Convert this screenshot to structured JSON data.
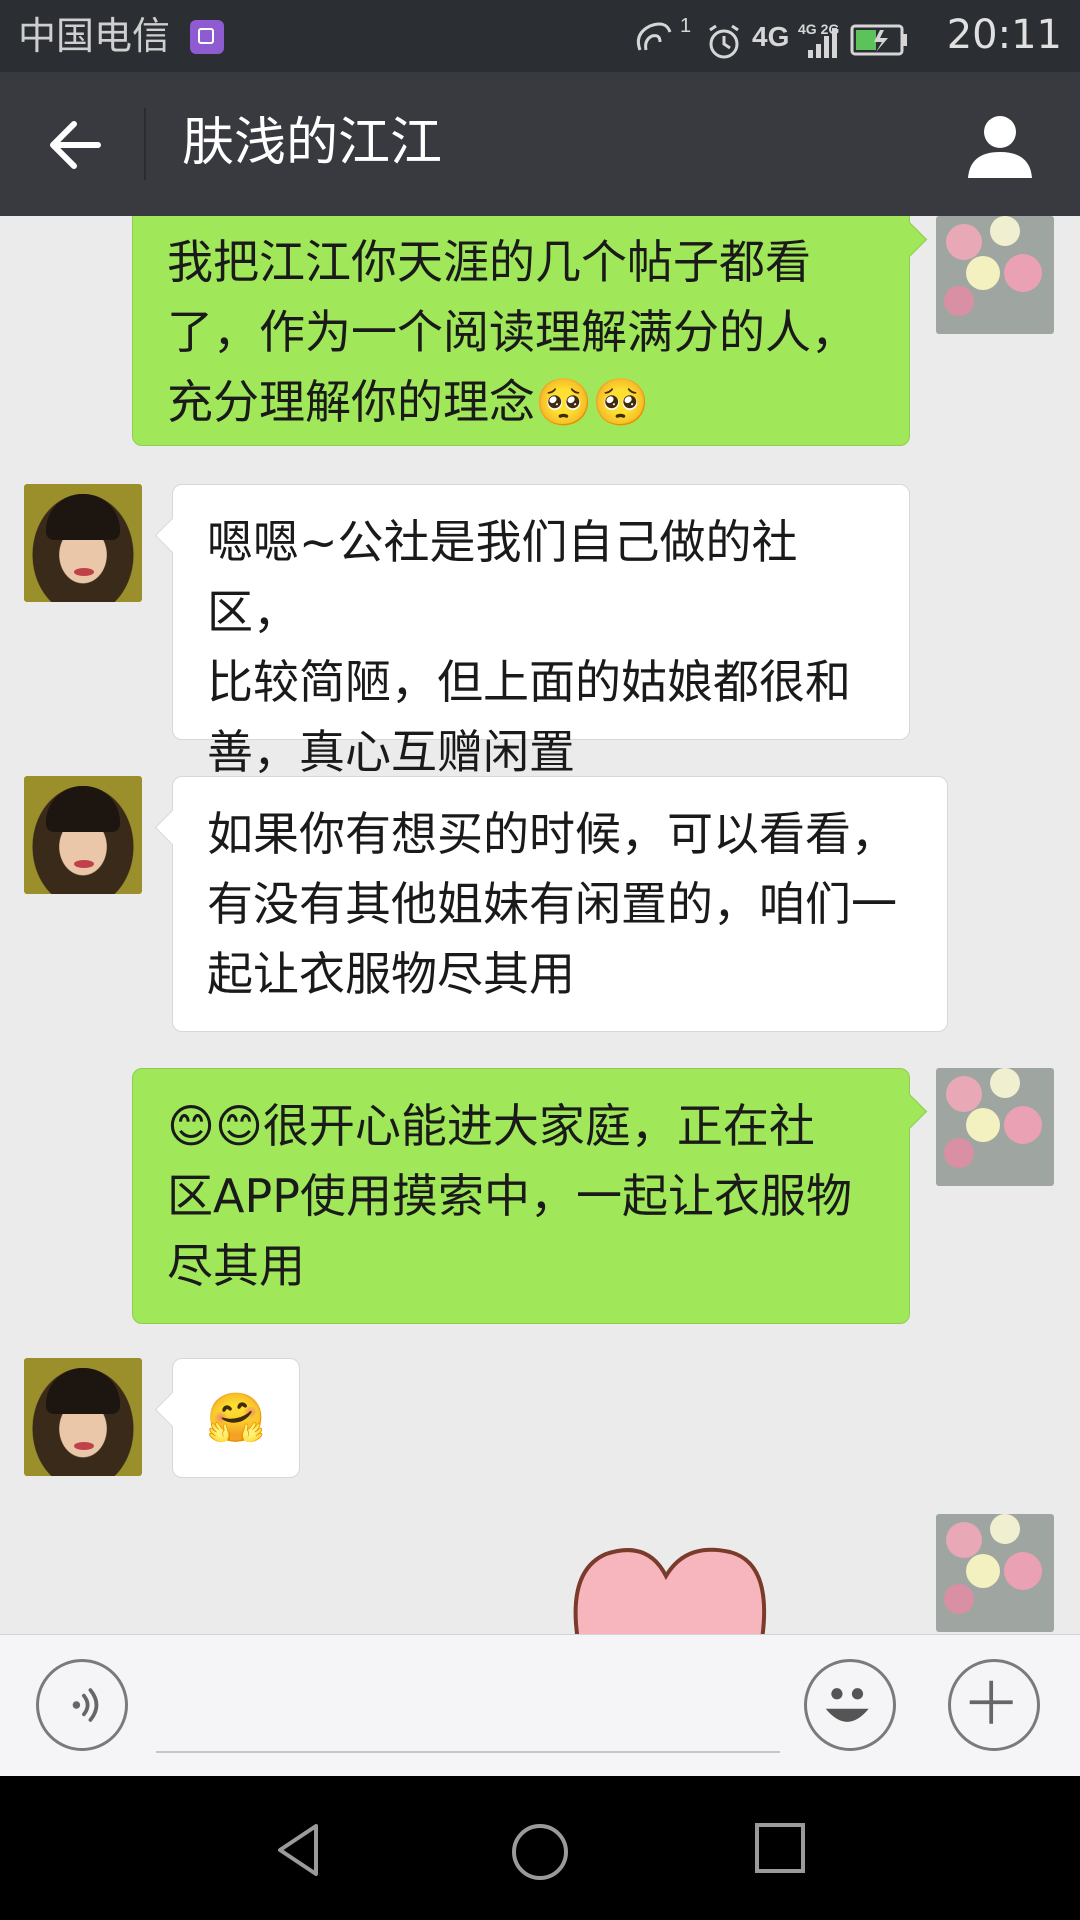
{
  "status_bar": {
    "carrier": "中国电信",
    "sim_indicator": "1",
    "network_4g": "4G",
    "network_4g2g": "4G 2G",
    "time": "20:11",
    "icons": [
      "photo-notification-icon",
      "hotspot-icon",
      "alarm-icon",
      "signal-icon",
      "battery-charging-icon"
    ]
  },
  "header": {
    "title": "肤浅的江江",
    "back_icon": "arrow-left-icon",
    "profile_icon": "person-icon"
  },
  "messages": [
    {
      "side": "out",
      "text": "我把江江你天涯的几个帖子都看\n了，作为一个阅读理解满分的人，\n充分理解你的理念🥺🥺"
    },
    {
      "side": "in",
      "text": "嗯嗯~公社是我们自己做的社区，\n比较简陋，但上面的姑娘都很和\n善，真心互赠闲置"
    },
    {
      "side": "in",
      "text": "如果你有想买的时候，可以看看，\n有没有其他姐妹有闲置的，咱们一\n起让衣服物尽其用"
    },
    {
      "side": "out",
      "text": "😊😊很开心能进大家庭，正在社\n区APP使用摸索中，一起让衣服物\n尽其用"
    },
    {
      "side": "in",
      "text": "🤗"
    }
  ],
  "input_bar": {
    "voice_icon": "voice-icon",
    "emoji_icon": "smiley-icon",
    "more_icon": "plus-icon"
  },
  "colors": {
    "status_bg": "#2b2f33",
    "header_bg": "#393a3f",
    "chat_bg": "#ebebeb",
    "bubble_out": "#a0e75a",
    "bubble_in": "#ffffff"
  }
}
